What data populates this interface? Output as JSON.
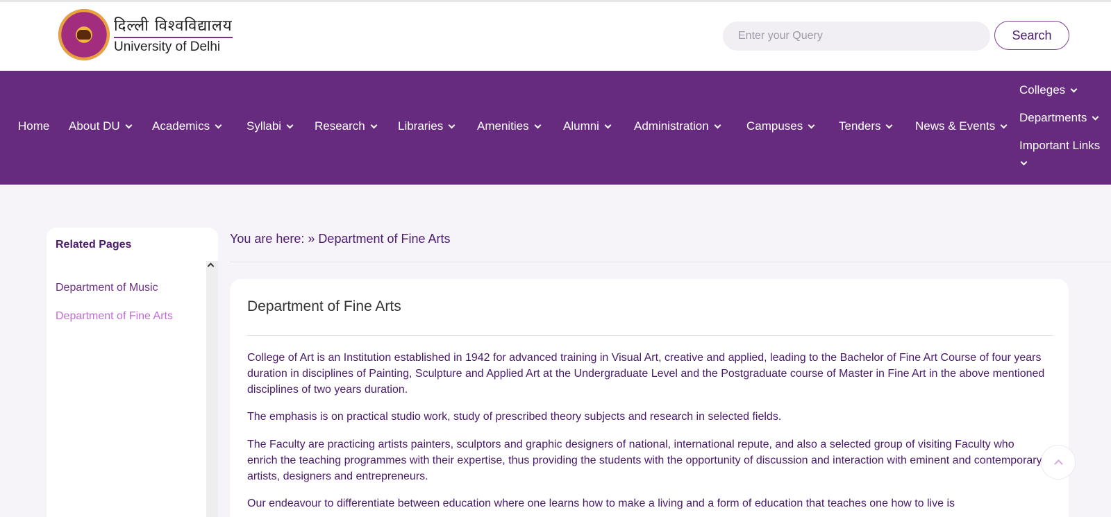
{
  "header": {
    "logo_hindi": "दिल्ली विश्वविद्यालय",
    "logo_english": "University of Delhi",
    "search_placeholder": "Enter your Query",
    "search_button": "Search"
  },
  "nav": {
    "items": [
      {
        "label": "Home",
        "has_dropdown": false
      },
      {
        "label": "About DU",
        "has_dropdown": true
      },
      {
        "label": "Academics",
        "has_dropdown": true
      },
      {
        "label": "Syllabi",
        "has_dropdown": true
      },
      {
        "label": "Research",
        "has_dropdown": true
      },
      {
        "label": "Libraries",
        "has_dropdown": true
      },
      {
        "label": "Amenities",
        "has_dropdown": true
      },
      {
        "label": "Alumni",
        "has_dropdown": true
      },
      {
        "label": "Administration",
        "has_dropdown": true
      },
      {
        "label": "Campuses",
        "has_dropdown": true
      },
      {
        "label": "Tenders",
        "has_dropdown": true
      },
      {
        "label": "News & Events",
        "has_dropdown": true
      }
    ],
    "right_items": [
      {
        "label": "Colleges",
        "has_dropdown": true
      },
      {
        "label": "Departments",
        "has_dropdown": true
      },
      {
        "label": "Important Links",
        "has_dropdown": true
      }
    ],
    "background_color": "#662a7e"
  },
  "sidebar": {
    "title": "Related Pages",
    "links": [
      {
        "label": "Department of Music",
        "active": false
      },
      {
        "label": "Department of Fine Arts",
        "active": true
      }
    ]
  },
  "breadcrumb": "You are here: » Department of Fine Arts",
  "content": {
    "title": "Department of Fine Arts",
    "paragraphs": [
      "College of Art is an Institution established in 1942 for advanced training in Visual Art, creative and applied, leading to the Bachelor of Fine Art Course of four years duration in disciplines of Painting, Sculpture and Applied Art at the Undergraduate Level and the Postgraduate course of Master in Fine Art in the above mentioned disciplines of two years duration.",
      "The emphasis is on practical studio work, study of prescribed theory subjects and research in selected fields.",
      "The Faculty are practicing artists painters, sculptors and graphic designers of national, international repute, and also a selected group of visiting Faculty who enrich the teaching programmes with their expertise, thus providing the students with the opportunity of discussion and interaction with eminent and contemporary artists, designers and entrepreneurs.",
      "Our endeavour to differentiate between education where one learns how to make a living and a form of education that teaches one how to live is"
    ]
  },
  "colors": {
    "accent": "#662a7e",
    "text": "#4a1a6b",
    "active_link": "#c36ad6",
    "page_bg": "#f7f4f9"
  },
  "icons": {
    "scroll_to_top": "chevron-up-icon",
    "dropdown": "chevron-down-icon"
  }
}
